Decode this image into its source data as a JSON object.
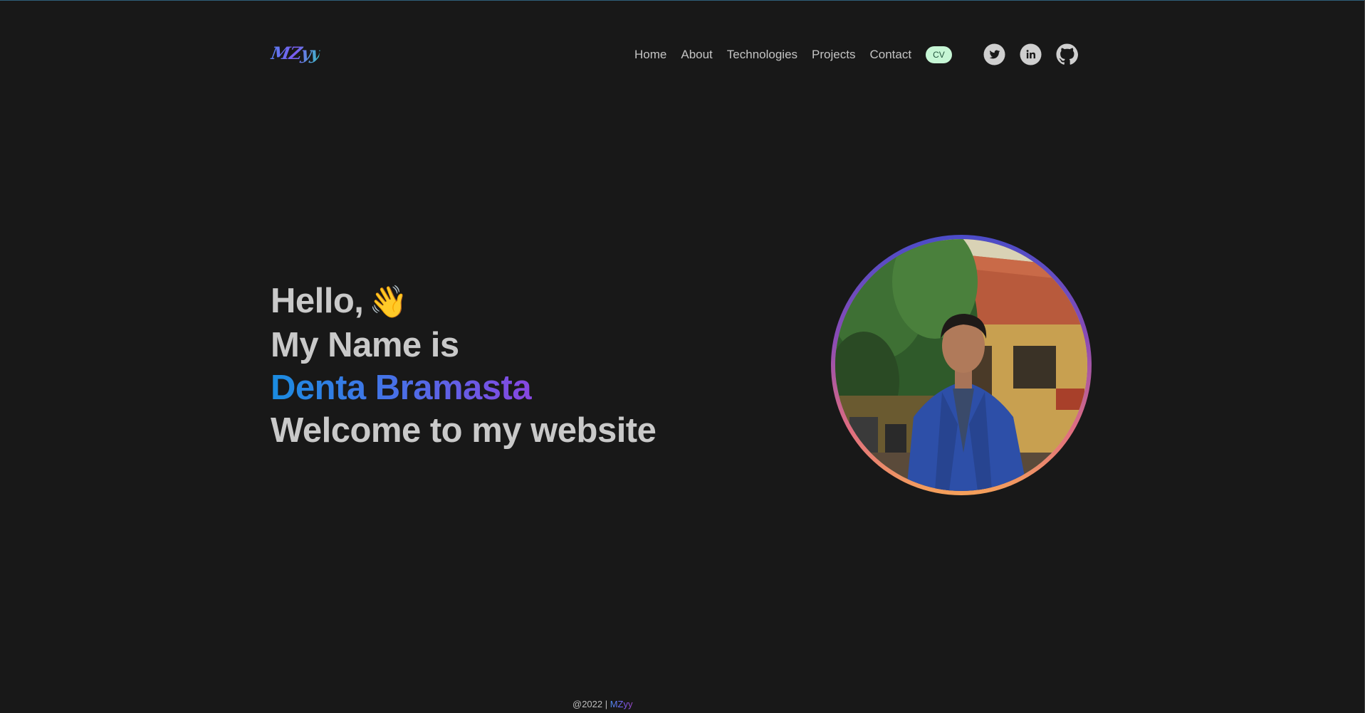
{
  "header": {
    "logo_text": "MZyy",
    "nav": [
      {
        "label": "Home"
      },
      {
        "label": "About"
      },
      {
        "label": "Technologies"
      },
      {
        "label": "Projects"
      },
      {
        "label": "Contact"
      }
    ],
    "cv_label": "CV",
    "social": [
      {
        "icon": "twitter-icon"
      },
      {
        "icon": "linkedin-icon"
      },
      {
        "icon": "github-icon"
      }
    ]
  },
  "hero": {
    "greeting": "Hello,",
    "greeting_emoji": "👋",
    "intro": "My Name is",
    "name": "Denta Bramasta",
    "welcome": "Welcome to my website"
  },
  "footer": {
    "copyright": "@2022 | ",
    "brand": "MZyy"
  },
  "colors": {
    "background": "#181818",
    "text": "#c9c9c9",
    "cv_badge_bg": "#c6f6d5",
    "name_gradient_start": "#1a8ce0",
    "name_gradient_end": "#6b2fa8"
  }
}
